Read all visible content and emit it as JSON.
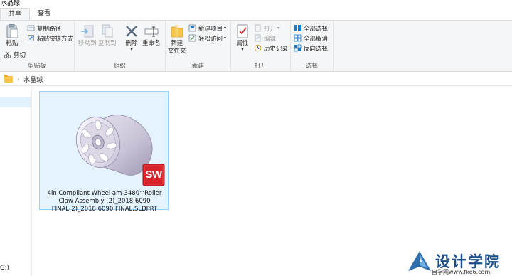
{
  "window": {
    "title": "水晶球"
  },
  "tabs": [
    {
      "label": "共享",
      "active": true
    },
    {
      "label": "查看",
      "active": false
    }
  ],
  "ribbon": {
    "clipboard": {
      "label": "剪贴板",
      "paste": "粘贴",
      "copy_path": "复制路径",
      "paste_shortcut": "粘贴快捷方式",
      "cut": "剪切"
    },
    "organize": {
      "label": "组织",
      "move_to": "移动到",
      "copy_to": "复制到",
      "delete": "删除",
      "rename": "重命名"
    },
    "new": {
      "label": "新建",
      "new_folder_line1": "新建",
      "new_folder_line2": "文件夹",
      "new_item": "新建项目",
      "easy_access": "轻松访问"
    },
    "open": {
      "label": "打开",
      "properties": "属性",
      "open": "打开",
      "edit": "编辑",
      "history": "历史记录"
    },
    "select": {
      "label": "选择",
      "select_all": "全部选择",
      "select_none": "全部取消",
      "invert": "反向选择"
    }
  },
  "address": {
    "crumb": "水晶球"
  },
  "navpane": {
    "bottom_label": "G:)"
  },
  "files": [
    {
      "name": "4in Compliant Wheel am-3480^Roller Claw Assembly (2)_2018 6090 FINAL(2)_2018 6090 FINAL.SLDPRT",
      "badge": "SW",
      "selected": true
    }
  ],
  "watermark": {
    "title": "设计学院",
    "subtitle": "自学网www.fke6.com"
  },
  "colors": {
    "accent": "#1979ca",
    "selection_bg": "#e5f3ff",
    "selection_border": "#99d1ff",
    "solidworks_red": "#d6242a"
  }
}
